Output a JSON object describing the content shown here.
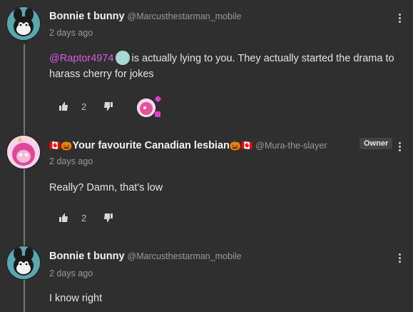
{
  "comments": [
    {
      "author": "Bonnie t bunny",
      "handle": "@Marcusthestarman_mobile",
      "time": "2 days ago",
      "mention": "@Raptor4974",
      "text": "is actually lying to you. They actually started the drama to harass cherry for jokes",
      "like_count": "2"
    },
    {
      "author_prefix_flag": "🇨🇦",
      "author_prefix_pumpkin": "🎃",
      "author": "Your favourite Canadian lesbian",
      "author_suffix_pumpkin": "🎃",
      "author_suffix_flag": "🇨🇦",
      "handle": "@Mura-the-slayer",
      "badge": "Owner",
      "time": "2 days ago",
      "text": "Really? Damn, that's low",
      "like_count": "2"
    },
    {
      "author": "Bonnie t bunny",
      "handle": "@Marcusthestarman_mobile",
      "time": "2 days ago",
      "text": "I know right"
    }
  ],
  "colors": {
    "background": "#2f2f2f",
    "mention": "#d65ce0",
    "muted": "#9a9a9a"
  }
}
